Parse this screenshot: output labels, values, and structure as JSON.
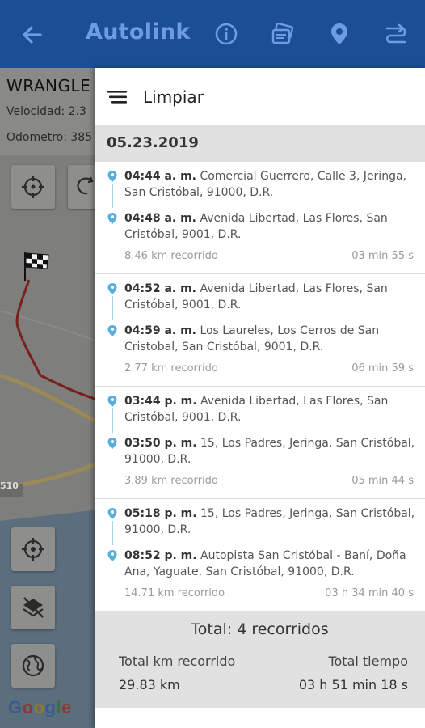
{
  "appbar": {
    "title": "Autolink",
    "accent": "#1a4f94"
  },
  "vehicle": {
    "name": "WRANGLE",
    "speed": "Velocidad: 2.3",
    "odometer": "Odometro: 385"
  },
  "map": {
    "road_label": "510",
    "google": [
      "G",
      "o",
      "o",
      "g",
      "l",
      "e"
    ]
  },
  "drawer": {
    "clear_label": "Limpiar",
    "date": "05.23.2019",
    "trips": [
      {
        "start": {
          "time": "04:44 a. m.",
          "address": "Comercial Guerrero, Calle 3, Jeringa, San Cristóbal, 91000, D.R."
        },
        "end": {
          "time": "04:48 a. m.",
          "address": "Avenida Libertad, Las Flores, San Cristóbal, 9001, D.R."
        },
        "distance": "8.46 km recorrido",
        "duration": "03 min 55 s"
      },
      {
        "start": {
          "time": "04:52 a. m.",
          "address": "Avenida Libertad, Las Flores, San Cristóbal, 9001, D.R."
        },
        "end": {
          "time": "04:59 a. m.",
          "address": "Los Laureles, Los Cerros de San Cristobal, San Cristóbal, 9001, D.R."
        },
        "distance": "2.77 km recorrido",
        "duration": "06 min 59 s"
      },
      {
        "start": {
          "time": "03:44 p. m.",
          "address": "Avenida Libertad, Las Flores, San Cristóbal, 9001, D.R."
        },
        "end": {
          "time": "03:50 p. m.",
          "address": "15, Los Padres, Jeringa, San Cristóbal, 91000, D.R."
        },
        "distance": "3.89 km recorrido",
        "duration": "05 min 44 s"
      },
      {
        "start": {
          "time": "05:18 p. m.",
          "address": "15, Los Padres, Jeringa, San Cristóbal, 91000, D.R."
        },
        "end": {
          "time": "08:52 p. m.",
          "address": "Autopista San Cristóbal - Baní, Doña Ana, Yaguate, San Cristóbal, 91000, D.R."
        },
        "distance": "14.71 km recorrido",
        "duration": "03 h 34 min 40 s"
      }
    ],
    "summary": {
      "total": "Total: 4 recorridos",
      "km_label": "Total km recorrido",
      "km_value": "29.83 km",
      "time_label": "Total tiempo",
      "time_value": "03 h 51 min 18 s"
    }
  }
}
